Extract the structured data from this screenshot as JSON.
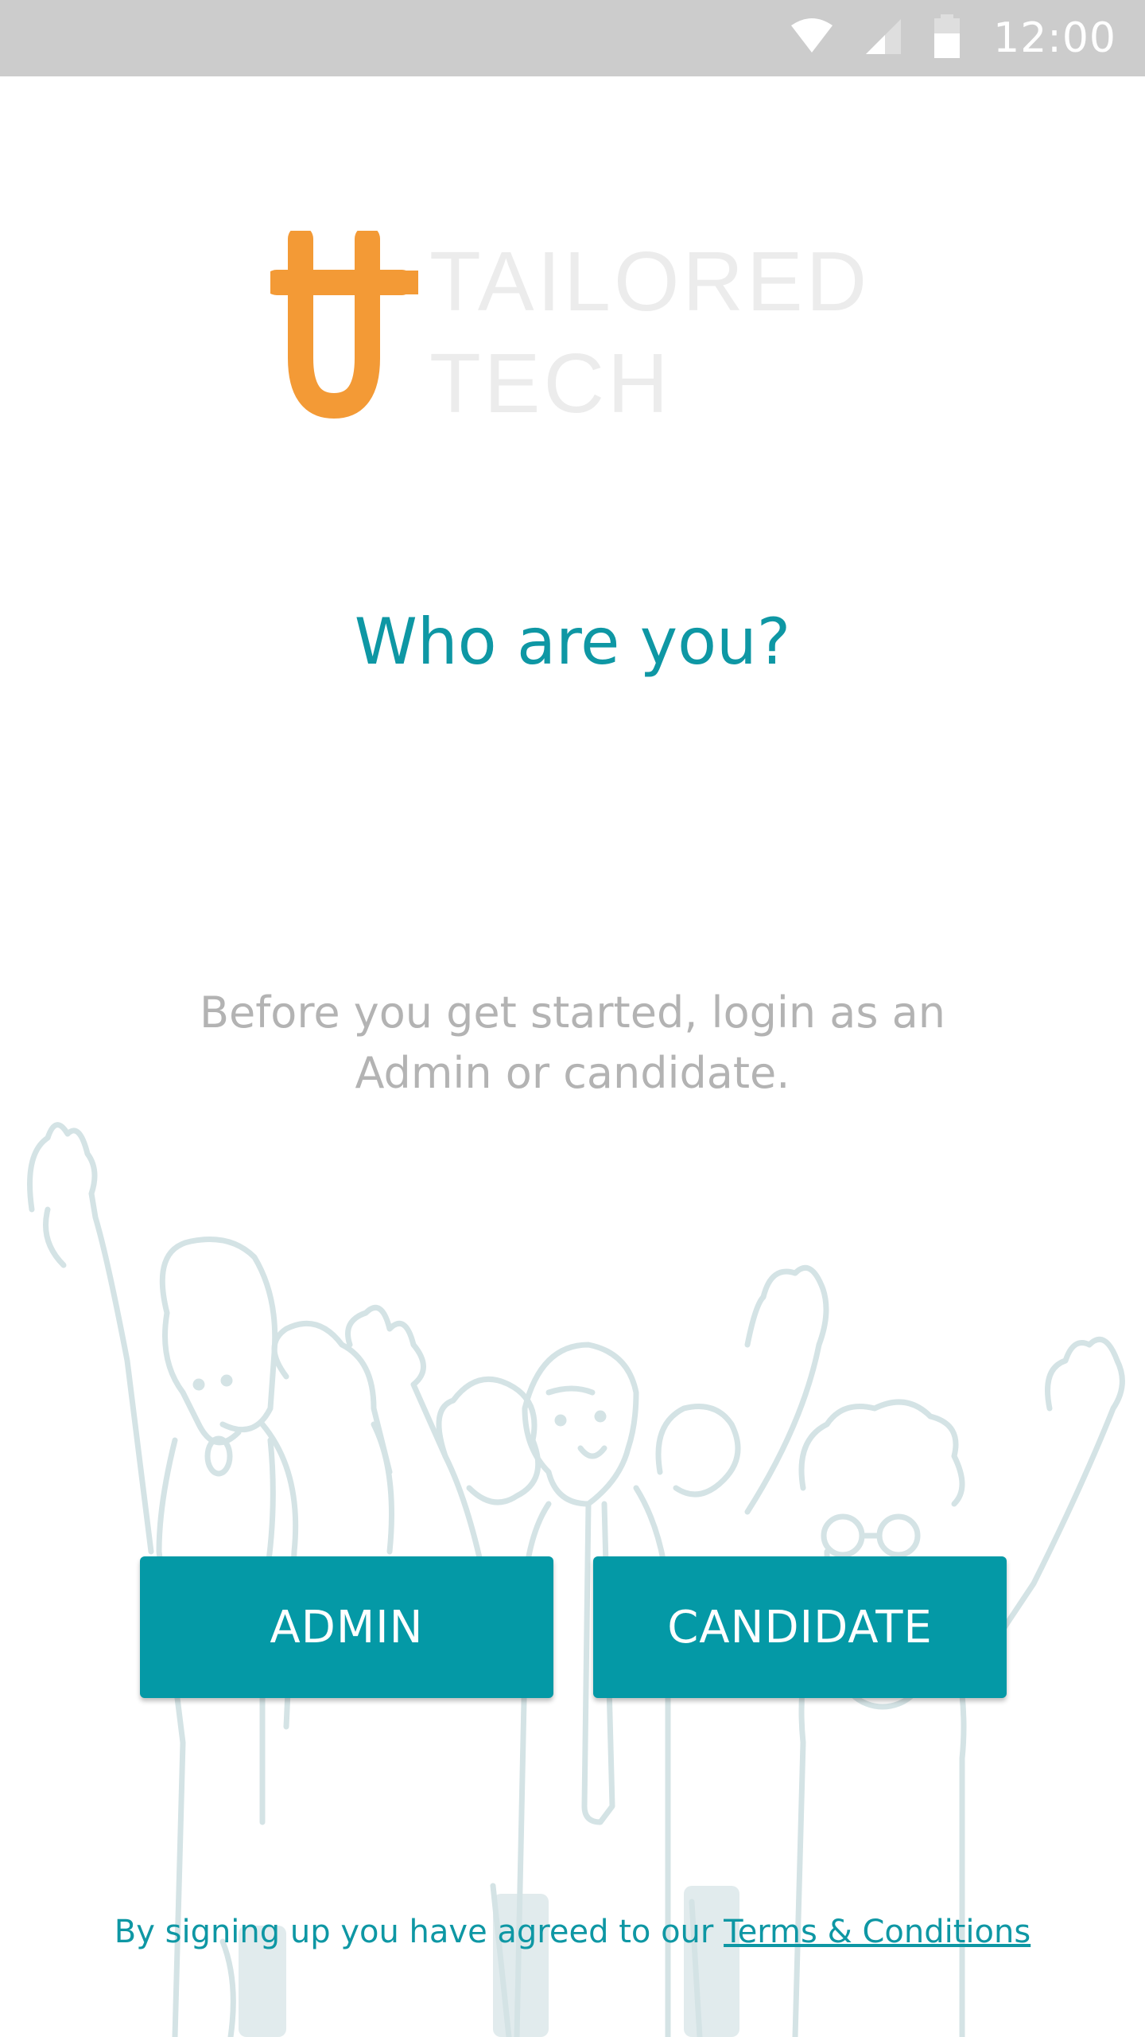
{
  "status_bar": {
    "time": "12:00",
    "icons": [
      "wifi-icon",
      "cell-signal-icon",
      "battery-icon"
    ]
  },
  "logo": {
    "line1": "TAILORED",
    "line2": "TECH",
    "brand_color": "#f39a36"
  },
  "heading": "Who are you?",
  "description": "Before you get started, login as an Admin or candidate.",
  "buttons": {
    "admin": "ADMIN",
    "candidate": "CANDIDATE"
  },
  "terms": {
    "prefix": "By signing up you have agreed to our ",
    "link": "Terms & Conditions"
  },
  "colors": {
    "accent": "#0499a6",
    "heading": "#0e97a4",
    "illustration": "#d4e3e5"
  }
}
